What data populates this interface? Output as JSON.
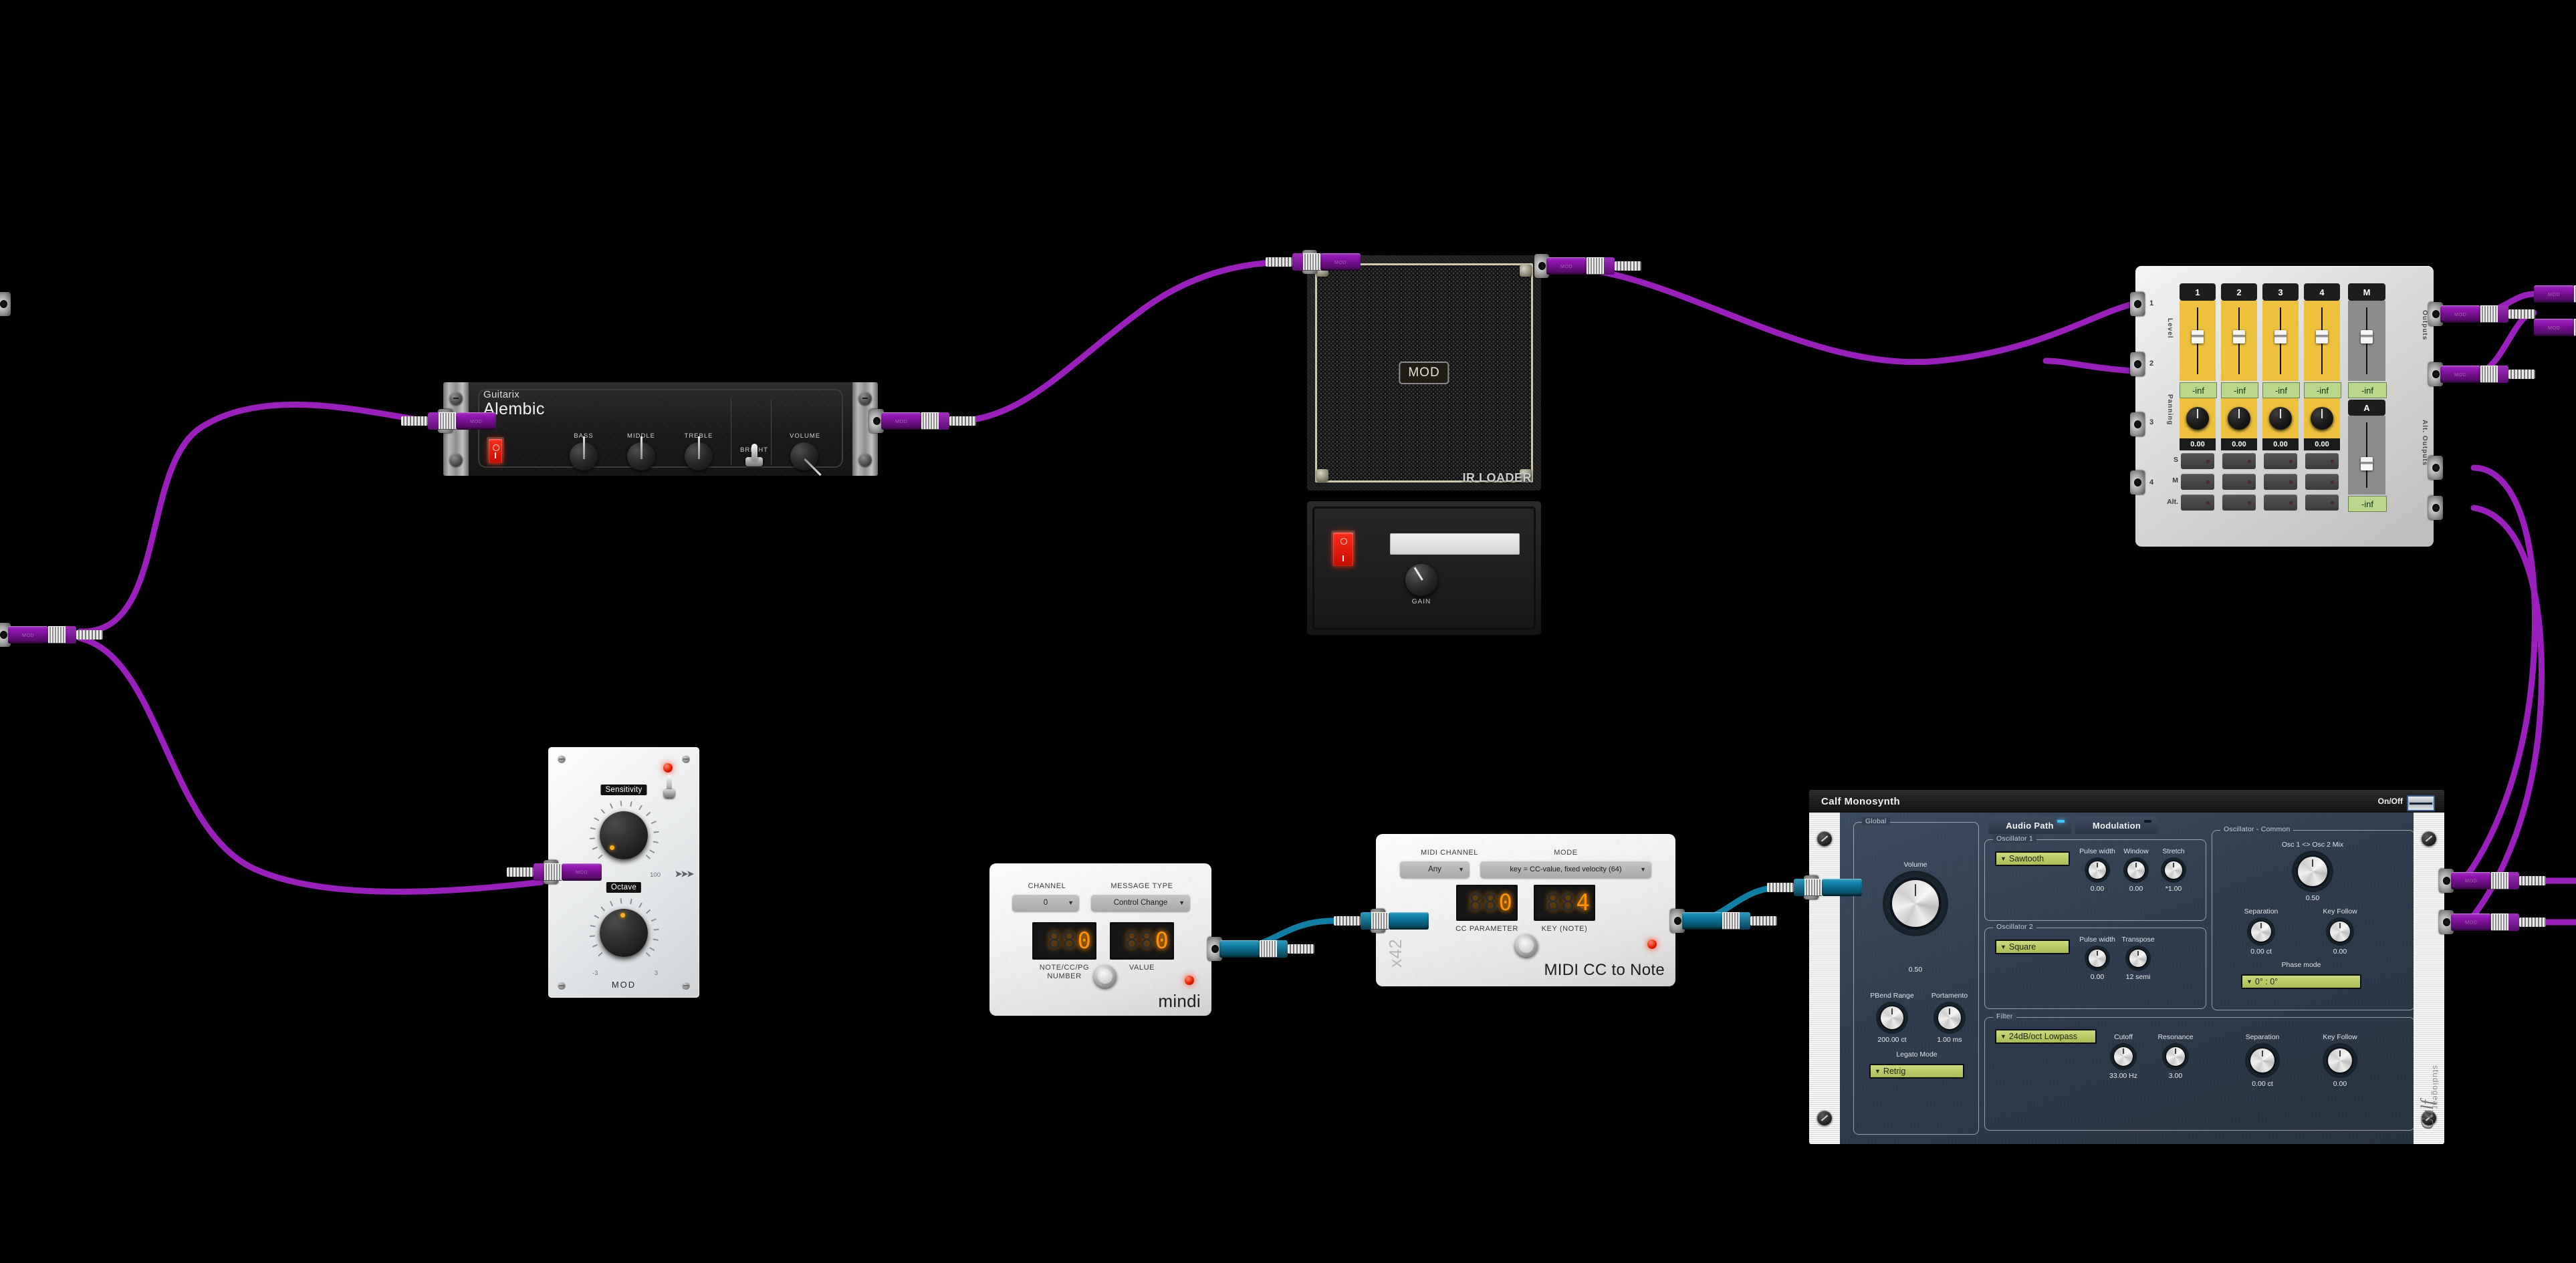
{
  "app": {
    "background": "#000000"
  },
  "cable_colors": {
    "audio": "#9b1fbd",
    "midi": "#0f7fa5"
  },
  "amp": {
    "brand": "Guitarix",
    "model": "Alembic",
    "power_on_label": "O",
    "power_off_label": "I",
    "knobs": [
      {
        "label": "BASS",
        "rotation": 0
      },
      {
        "label": "MIDDLE",
        "rotation": 0
      },
      {
        "label": "TREBLE",
        "rotation": 0
      }
    ],
    "switch": {
      "label": "BRIGHT"
    },
    "volume": {
      "label": "VOLUME"
    }
  },
  "cab": {
    "logo": "MOD",
    "name": "IR LOADER",
    "file_value": "",
    "gain": {
      "label": "GAIN"
    },
    "power": {
      "on": "I",
      "off": "O"
    }
  },
  "octaver": {
    "sensitivity": {
      "label": "Sensitivity",
      "min": "0",
      "max": "100"
    },
    "octave": {
      "label": "Octave",
      "min": "-3",
      "max": "3"
    },
    "brand": "MOD",
    "arrows": "➤➤➤"
  },
  "mindi": {
    "brand": "mindi",
    "channel": {
      "label": "CHANNEL",
      "value": "0"
    },
    "message_type": {
      "label": "MESSAGE TYPE",
      "value": "Control Change"
    },
    "number": {
      "label": "NOTE/CC/PG NUMBER",
      "value": "0",
      "ghost": "888"
    },
    "value": {
      "label": "VALUE",
      "value": "0",
      "ghost": "888"
    }
  },
  "ccnote": {
    "brand": "MIDI CC to Note",
    "side_brand": "x42",
    "midi_channel": {
      "label": "MIDI CHANNEL",
      "value": "Any"
    },
    "mode": {
      "label": "MODE",
      "value": "key = CC-value, fixed velocity (64)"
    },
    "cc_parameter": {
      "label": "CC PARAMETER",
      "value": "0",
      "ghost": "888"
    },
    "key_note": {
      "label": "KEY (NOTE)",
      "value": "4",
      "ghost": "888"
    }
  },
  "mixer": {
    "side_left_nums": [
      "1",
      "2",
      "3",
      "4"
    ],
    "left_labels": {
      "level": "Level",
      "panning": "Panning"
    },
    "row_labels": [
      "S",
      "M",
      "Alt."
    ],
    "right_labels": {
      "outputs": "Outputs",
      "alt_outputs": "Alt. Outputs"
    },
    "channels": [
      {
        "name": "1",
        "level": "-inf",
        "pan": "0.00"
      },
      {
        "name": "2",
        "level": "-inf",
        "pan": "0.00"
      },
      {
        "name": "3",
        "level": "-inf",
        "pan": "0.00"
      },
      {
        "name": "4",
        "level": "-inf",
        "pan": "0.00"
      }
    ],
    "master": {
      "name": "M",
      "level": "-inf"
    },
    "alt": {
      "name": "A",
      "level": "-inf"
    }
  },
  "calf": {
    "title": "Calf Monosynth",
    "onoff_label": "On/Off",
    "logo": "Calf",
    "logo_sub": "studiogear",
    "tabs": [
      {
        "label": "Audio Path",
        "active": true
      },
      {
        "label": "Modulation",
        "active": false
      }
    ],
    "global": {
      "group": "Global",
      "volume": {
        "label": "Volume",
        "value": "0.50"
      },
      "pbend_range": {
        "label": "PBend Range",
        "value": "200.00 ct"
      },
      "portamento": {
        "label": "Portamento",
        "value": "1.00 ms"
      },
      "legato_mode": {
        "label": "Legato Mode",
        "value": "Retrig"
      }
    },
    "osc1": {
      "group": "Oscillator 1",
      "wave": "Sawtooth",
      "knobs": [
        {
          "label": "Pulse width",
          "value": "0.00"
        },
        {
          "label": "Window",
          "value": "0.00"
        },
        {
          "label": "Stretch",
          "value": "*1.00"
        }
      ]
    },
    "osc2": {
      "group": "Oscillator 2",
      "wave": "Square",
      "knobs": [
        {
          "label": "Pulse width",
          "value": "0.00"
        },
        {
          "label": "Transpose",
          "value": "12 semi"
        }
      ]
    },
    "osc_common": {
      "group": "Oscillator - Common",
      "mix": {
        "label": "Osc 1 <> Osc 2 Mix",
        "value": "0.50"
      },
      "separation": {
        "label": "Separation",
        "value": "0.00 ct"
      },
      "key_follow": {
        "label": "Key Follow",
        "value": "0.00"
      },
      "phase_mode": {
        "label": "Phase mode",
        "value": "0° : 0°"
      }
    },
    "filter": {
      "group": "Filter",
      "type": "24dB/oct Lowpass",
      "knobs": [
        {
          "label": "Cutoff",
          "value": "33.00 Hz"
        },
        {
          "label": "Resonance",
          "value": "3.00"
        },
        {
          "label": "Separation",
          "value": "0.00 ct"
        },
        {
          "label": "Key Follow",
          "value": "0.00"
        }
      ]
    }
  }
}
